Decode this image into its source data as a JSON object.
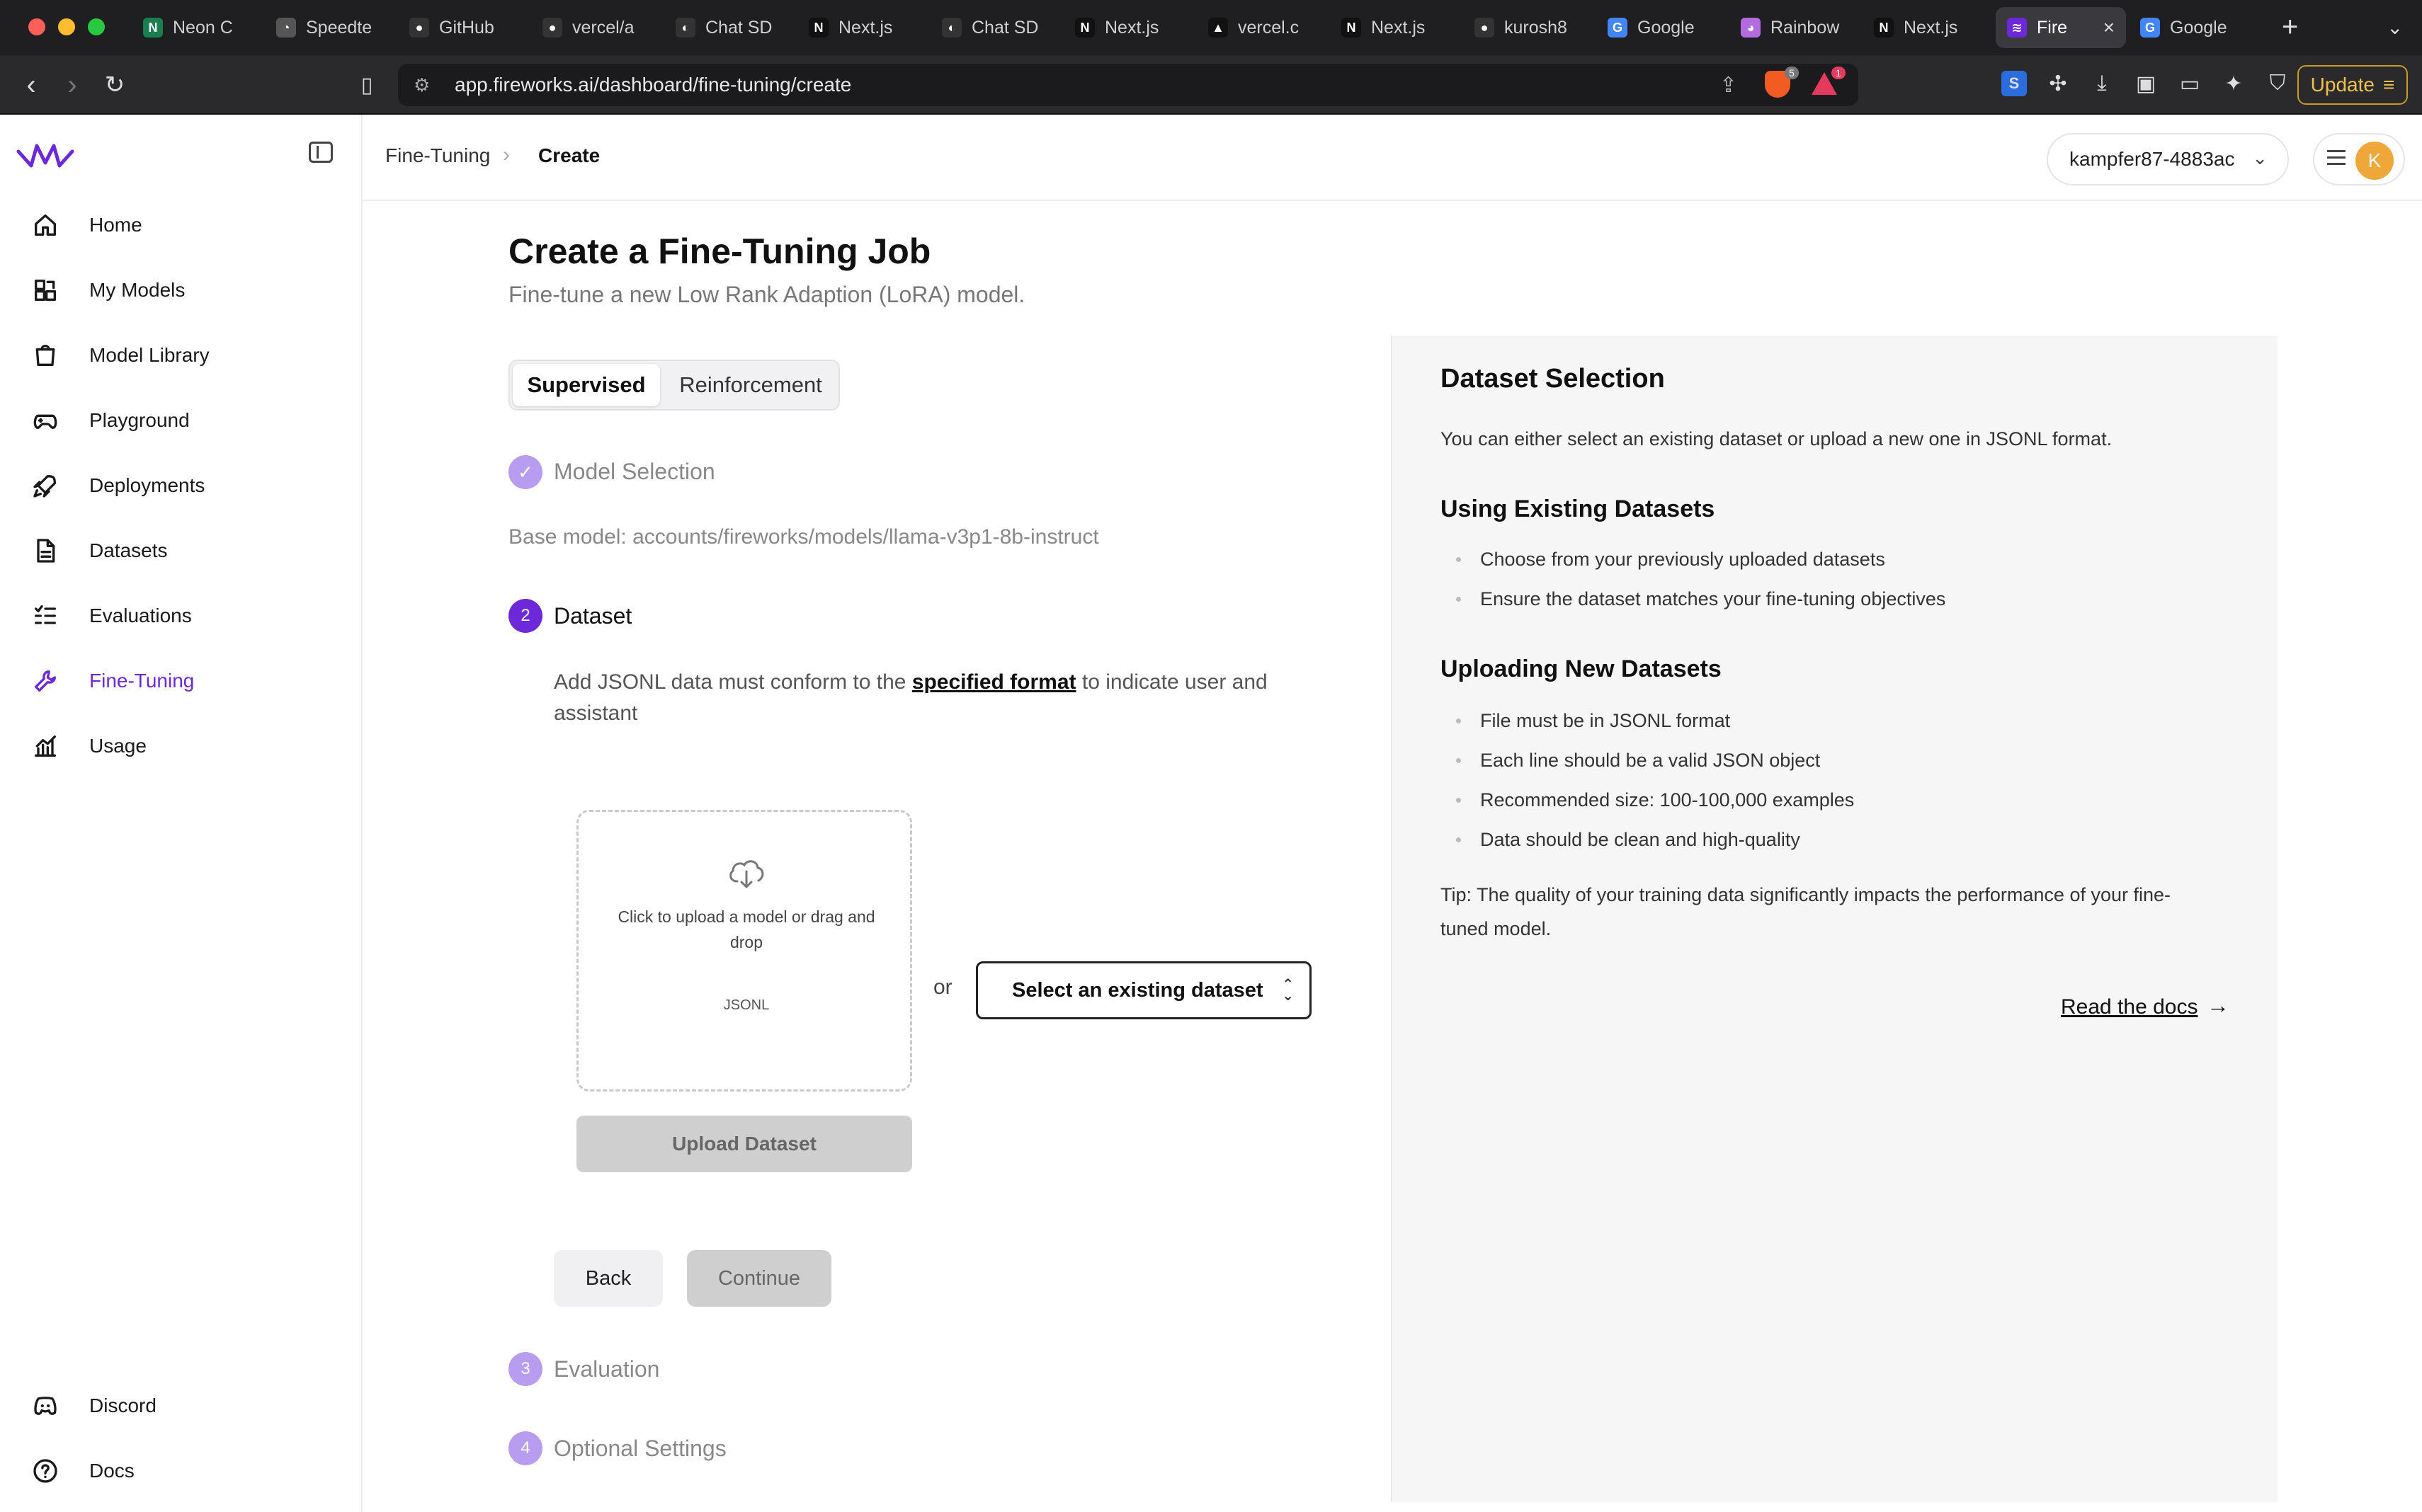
{
  "browser": {
    "tabs": [
      {
        "title": "Neon C",
        "color": "#1a7f4f",
        "glyph": "N"
      },
      {
        "title": "Speedte",
        "color": "#555555",
        "glyph": "◔"
      },
      {
        "title": "GitHub",
        "color": "#333333",
        "glyph": "●"
      },
      {
        "title": "vercel/a",
        "color": "#333333",
        "glyph": "●"
      },
      {
        "title": "Chat SD",
        "color": "#333333",
        "glyph": "◐"
      },
      {
        "title": "Next.js",
        "color": "#111111",
        "glyph": "N"
      },
      {
        "title": "Chat SD",
        "color": "#333333",
        "glyph": "◐"
      },
      {
        "title": "Next.js",
        "color": "#111111",
        "glyph": "N"
      },
      {
        "title": "vercel.c",
        "color": "#111111",
        "glyph": "▲"
      },
      {
        "title": "Next.js",
        "color": "#111111",
        "glyph": "N"
      },
      {
        "title": "kurosh8",
        "color": "#333333",
        "glyph": "●"
      },
      {
        "title": "Google",
        "color": "#4285f4",
        "glyph": "G"
      },
      {
        "title": "Rainbow",
        "color": "#b46be0",
        "glyph": "◕"
      },
      {
        "title": "Next.js",
        "color": "#111111",
        "glyph": "N"
      },
      {
        "title": "Fire",
        "color": "#6d28d9",
        "glyph": "≋",
        "active": true
      },
      {
        "title": "Google",
        "color": "#4285f4",
        "glyph": "G"
      }
    ],
    "url": "app.fireworks.ai/dashboard/fine-tuning/create",
    "brave_count": "5",
    "alert_count": "1",
    "update_label": "Update"
  },
  "sidebar": {
    "items": [
      {
        "label": "Home",
        "icon": "home-icon"
      },
      {
        "label": "My Models",
        "icon": "models-icon"
      },
      {
        "label": "Model Library",
        "icon": "library-icon"
      },
      {
        "label": "Playground",
        "icon": "gamepad-icon"
      },
      {
        "label": "Deployments",
        "icon": "rocket-icon"
      },
      {
        "label": "Datasets",
        "icon": "document-icon"
      },
      {
        "label": "Evaluations",
        "icon": "checklist-icon"
      },
      {
        "label": "Fine-Tuning",
        "icon": "wrench-icon",
        "active": true
      },
      {
        "label": "Usage",
        "icon": "chart-icon"
      }
    ],
    "bottom": [
      {
        "label": "Discord",
        "icon": "discord-icon"
      },
      {
        "label": "Docs",
        "icon": "help-icon"
      }
    ],
    "accent_color": "#6d28d9"
  },
  "header": {
    "breadcrumb": [
      "Fine-Tuning",
      "Create"
    ],
    "account": "kampfer87-4883ac",
    "avatar_initial": "K"
  },
  "main": {
    "title": "Create a Fine-Tuning Job",
    "subtitle": "Fine-tune a new Low Rank Adaption (LoRA) model.",
    "tabs": [
      "Supervised",
      "Reinforcement"
    ],
    "steps": [
      {
        "number": "✓",
        "label": "Model Selection",
        "state": "done"
      },
      {
        "number": "2",
        "label": "Dataset",
        "state": "current"
      },
      {
        "number": "3",
        "label": "Evaluation",
        "state": "pending"
      },
      {
        "number": "4",
        "label": "Optional Settings",
        "state": "pending"
      }
    ],
    "base_model": "Base model: accounts/fireworks/models/llama-v3p1-8b-instruct",
    "dataset_desc_pre": "Add JSONL data must conform to the ",
    "dataset_desc_link": "specified format",
    "dataset_desc_post": " to indicate user and assistant",
    "dropzone_text": "Click to upload a model or drag and drop",
    "dropzone_format": "JSONL",
    "or_label": "or",
    "select_label": "Select an existing dataset",
    "upload_label": "Upload Dataset",
    "back_label": "Back",
    "continue_label": "Continue"
  },
  "panel": {
    "title": "Dataset Selection",
    "intro": "You can either select an existing dataset or upload a new one in JSONL format.",
    "existing_title": "Using Existing Datasets",
    "existing_items": [
      "Choose from your previously uploaded datasets",
      "Ensure the dataset matches your fine-tuning objectives"
    ],
    "upload_title": "Uploading New Datasets",
    "upload_items": [
      "File must be in JSONL format",
      "Each line should be a valid JSON object",
      "Recommended size: 100-100,000 examples",
      "Data should be clean and high-quality"
    ],
    "tip": "Tip: The quality of your training data significantly impacts the performance of your fine-tuned model.",
    "docs_link": "Read the docs"
  }
}
